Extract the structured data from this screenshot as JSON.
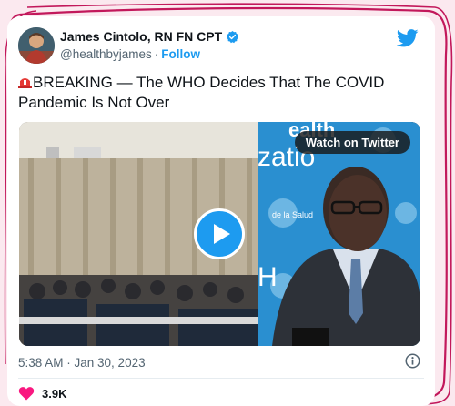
{
  "tweet": {
    "author_name": "James Cintolo, RN FN CPT",
    "handle": "@healthbyjames",
    "follow_label": "Follow",
    "text": "BREAKING — The WHO Decides That The COVID Pandemic Is Not Over",
    "timestamp": "5:38 AM · Jan 30, 2023",
    "like_count": "3.9K"
  },
  "media": {
    "watch_label": "Watch on Twitter",
    "backdrop_text_top": "ealth",
    "backdrop_text_mid": "zatio",
    "backdrop_text_bottom": "H",
    "backdrop_text_small": "de la Salud"
  },
  "colors": {
    "accent": "#1d9bf0",
    "text": "#0f1419",
    "muted": "#536471",
    "like": "#f91880",
    "scribble": "#c2185b"
  },
  "icons": [
    "verified-badge-icon",
    "twitter-bird-icon",
    "siren-icon",
    "play-icon",
    "info-icon",
    "heart-icon"
  ]
}
